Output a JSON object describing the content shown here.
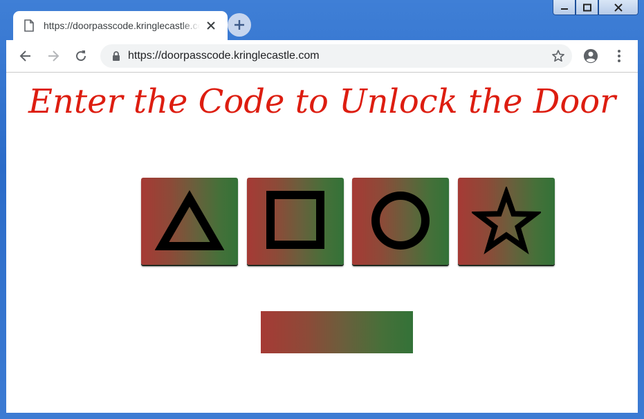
{
  "browser": {
    "tab_title": "https://doorpasscode.kringlecastle.com",
    "url": "https://doorpasscode.kringlecastle.com"
  },
  "page": {
    "title": "Enter the Code to Unlock the Door",
    "buttons": [
      {
        "shape": "triangle-icon"
      },
      {
        "shape": "square-icon"
      },
      {
        "shape": "circle-icon"
      },
      {
        "shape": "star-icon"
      }
    ],
    "code_value": ""
  },
  "colors": {
    "title": "#dd1d10",
    "gradient_red": "#a63a35",
    "gradient_green": "#337238"
  }
}
